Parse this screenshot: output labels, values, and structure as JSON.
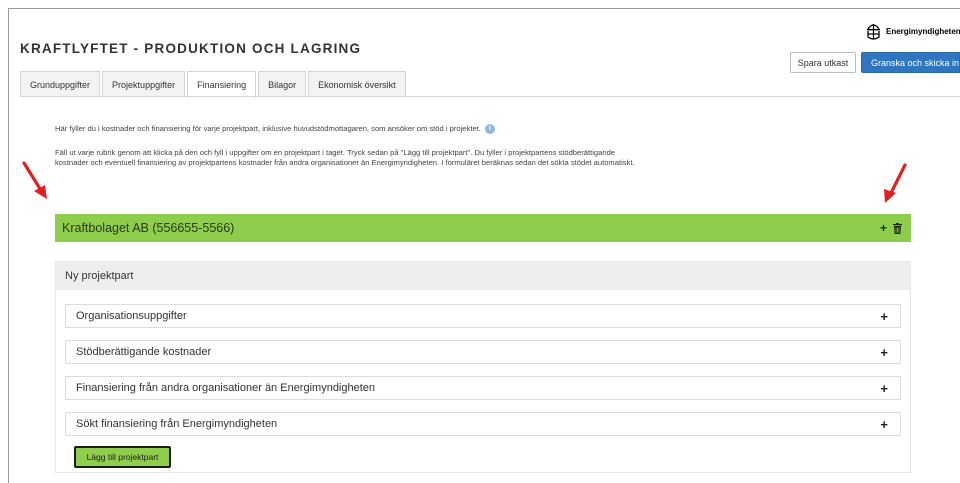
{
  "header": {
    "title": "KRAFTLYFTET - PRODUKTION OCH LAGRING",
    "logo_text": "Energimyndigheten",
    "draft_label": "Spara utkast",
    "submit_label": "Granska och skicka in"
  },
  "tabs": [
    {
      "label": "Grunduppgifter",
      "active": false
    },
    {
      "label": "Projektuppgifter",
      "active": false
    },
    {
      "label": "Finansiering",
      "active": true
    },
    {
      "label": "Bilagor",
      "active": false
    },
    {
      "label": "Ekonomisk översikt",
      "active": false
    }
  ],
  "info": {
    "line1": "Här fyller du i kostnader och finansiering för varje projektpart, inklusive huvudstödmottagaren, som ansöker om stöd i projektet.",
    "line2": "Fäll ut varje rubrik genom att klicka på den och fyll i uppgifter om en projektpart i taget. Tryck sedan på \"Lägg till projektpart\". Du fyller i projektpartens stödberättigande kostnader och eventuell finansiering av projektpartens kostnader från andra organisationer än Energimyndigheten. I formuläret beräknas sedan det sökta stödet automatiskt."
  },
  "project_part": {
    "name": "Kraftbolaget AB (556655-5566)"
  },
  "new_part": {
    "header": "Ny projektpart",
    "sections": [
      {
        "label": "Organisationsuppgifter"
      },
      {
        "label": "Stödberättigande kostnader"
      },
      {
        "label": "Finansiering från andra organisationer än Energimyndigheten"
      },
      {
        "label": "Sökt finansiering från Energimyndigheten"
      }
    ],
    "add_button": "Lägg till projektpart"
  },
  "colors": {
    "accent_green": "#8fce4d",
    "primary_blue": "#2f75c0",
    "annotation_red": "#e02020"
  }
}
